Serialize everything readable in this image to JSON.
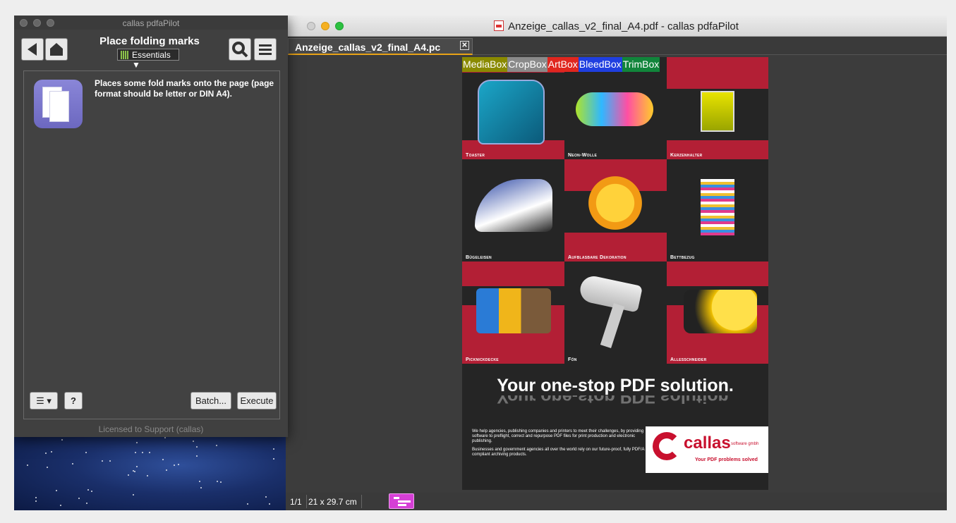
{
  "panel": {
    "title": "callas pdfaPilot",
    "heading": "Place folding marks",
    "profile_selector": "Essentials",
    "description": "Places some fold marks onto the page (page format should be letter or DIN A4).",
    "buttons": {
      "menu": "☰ ▾",
      "help": "?",
      "batch": "Batch...",
      "execute": "Execute"
    },
    "license": "Licensed to Support (callas)"
  },
  "viewer": {
    "title": "Anzeige_callas_v2_final_A4.pdf - callas pdfaPilot",
    "tab_label": "Anzeige_callas_v2_final_A4.pc",
    "tab_close": "✕",
    "status": {
      "page": "1/1",
      "size": "21 x 29.7 cm"
    }
  },
  "pdf": {
    "box_labels": [
      {
        "text": "MediaBox",
        "color": "#8a8a00"
      },
      {
        "text": "CropBox",
        "color": "#8a8a8a"
      },
      {
        "text": "ArtBox",
        "color": "#e0261e"
      },
      {
        "text": "BleedBox",
        "color": "#1f3fe0"
      },
      {
        "text": "TrimBox",
        "color": "#11853b"
      }
    ],
    "products": [
      "Toaster",
      "Neon-Wolle",
      "Kerzenhalter",
      "Bügeleisen",
      "Aufblasbare Dekoration",
      "Bettbezug",
      "Picknickdecke",
      "Fön",
      "Allesschneider"
    ],
    "slogan": "Your one-stop PDF solution.",
    "blurb_1": "We help agencies, publishing companies and printers to meet their challenges, by providing software to preflight, correct and repurpose PDF files for print production and electronic publishing.",
    "blurb_2": "Businesses and government agencies all over the world rely on our future-proof, fully PDF/A compliant archiving products.",
    "logo_name": "callas",
    "logo_suffix": "software gmbh",
    "logo_tagline": "Your PDF problems solved"
  }
}
